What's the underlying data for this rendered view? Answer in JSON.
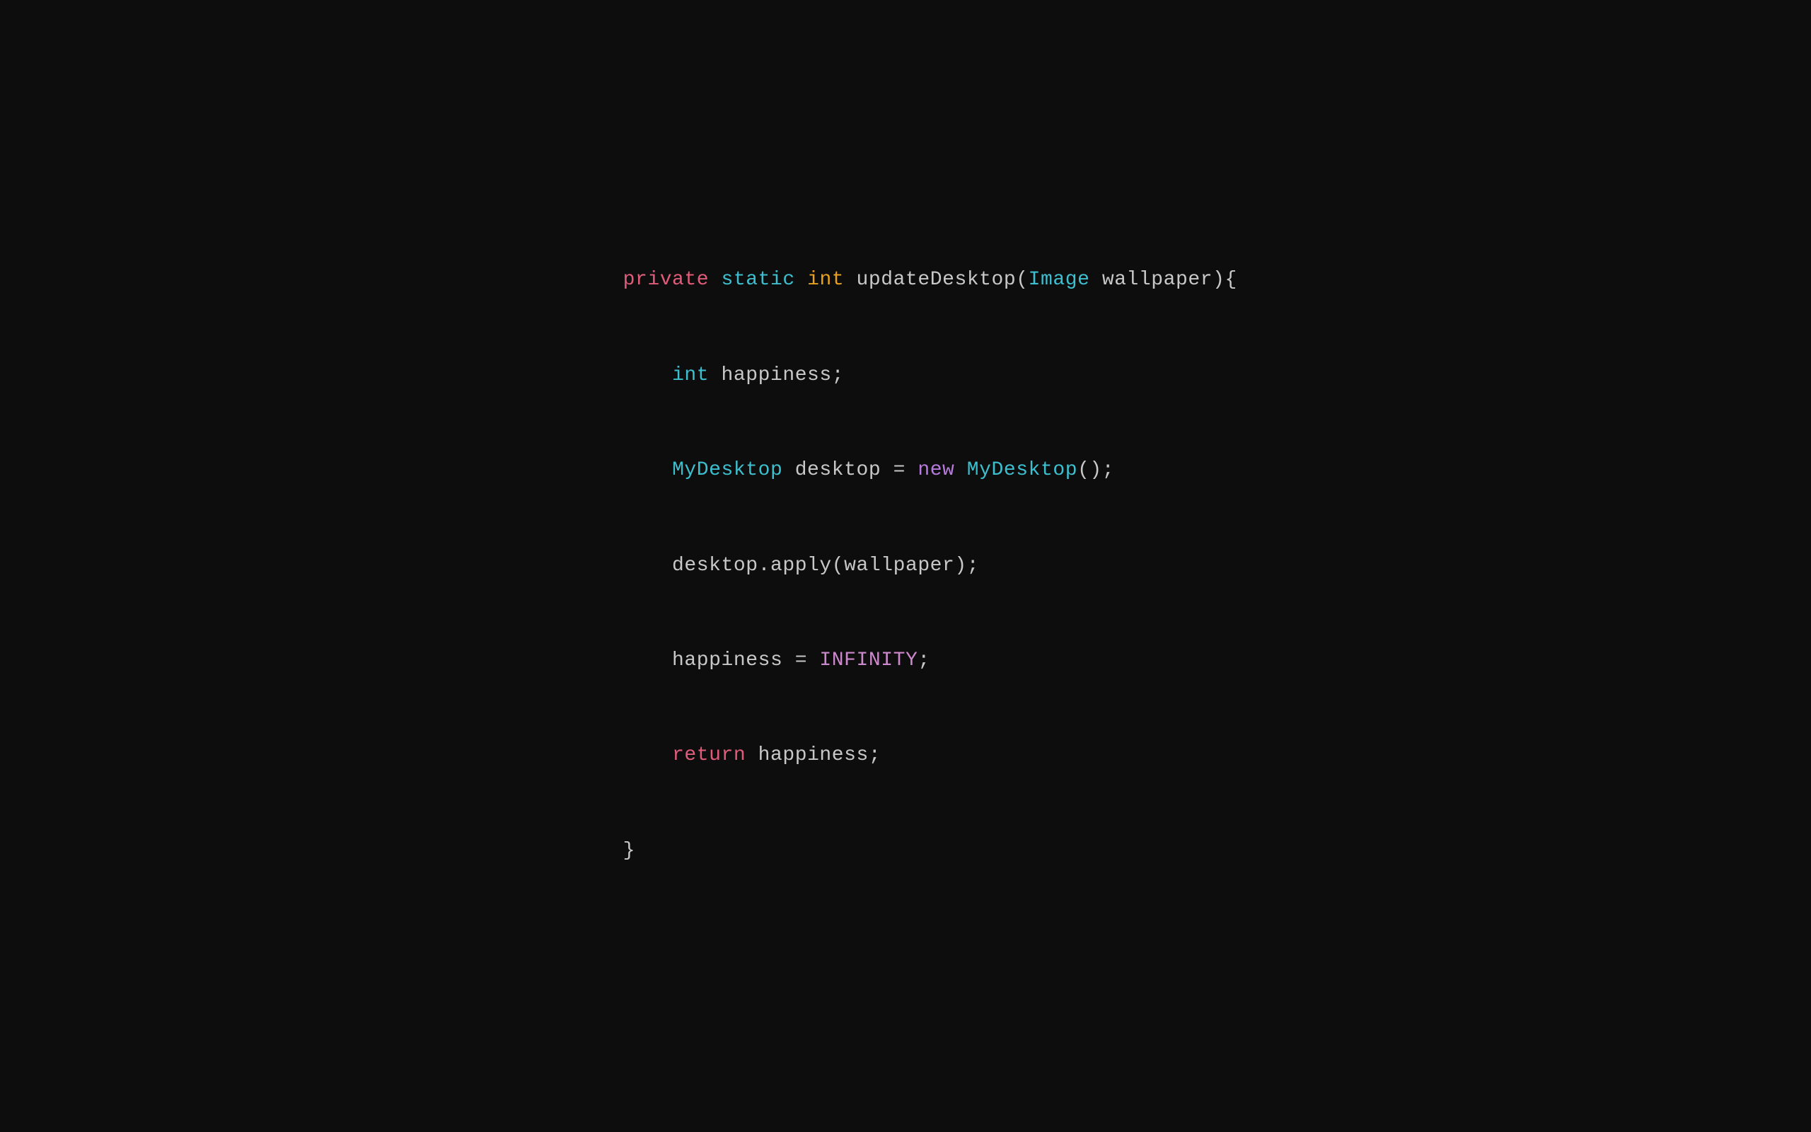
{
  "code": {
    "line1": {
      "segments": [
        {
          "text": "private",
          "class": "keyword-private"
        },
        {
          "text": " ",
          "class": "plain"
        },
        {
          "text": "static",
          "class": "keyword-static"
        },
        {
          "text": " ",
          "class": "plain"
        },
        {
          "text": "int",
          "class": "keyword-int"
        },
        {
          "text": " updateDesktop(",
          "class": "plain"
        },
        {
          "text": "Image",
          "class": "class-name"
        },
        {
          "text": " wallpaper){",
          "class": "plain"
        }
      ]
    },
    "line2": {
      "segments": [
        {
          "text": "    ",
          "class": "plain"
        },
        {
          "text": "int",
          "class": "class-name"
        },
        {
          "text": " happiness;",
          "class": "plain"
        }
      ]
    },
    "line3": {
      "segments": [
        {
          "text": "    ",
          "class": "plain"
        },
        {
          "text": "MyDesktop",
          "class": "class-name"
        },
        {
          "text": " desktop = ",
          "class": "plain"
        },
        {
          "text": "new",
          "class": "keyword-new"
        },
        {
          "text": " ",
          "class": "plain"
        },
        {
          "text": "MyDesktop",
          "class": "class-name"
        },
        {
          "text": "();",
          "class": "plain"
        }
      ]
    },
    "line4": {
      "segments": [
        {
          "text": "    desktop.apply(wallpaper);",
          "class": "plain"
        }
      ]
    },
    "line5": {
      "segments": [
        {
          "text": "    happiness = ",
          "class": "plain"
        },
        {
          "text": "INFINITY",
          "class": "infinity"
        },
        {
          "text": ";",
          "class": "plain"
        }
      ]
    },
    "line6": {
      "segments": [
        {
          "text": "    ",
          "class": "plain"
        },
        {
          "text": "return",
          "class": "keyword-return"
        },
        {
          "text": " happiness;",
          "class": "plain"
        }
      ]
    },
    "line7": {
      "segments": [
        {
          "text": "}",
          "class": "brace"
        }
      ]
    }
  }
}
